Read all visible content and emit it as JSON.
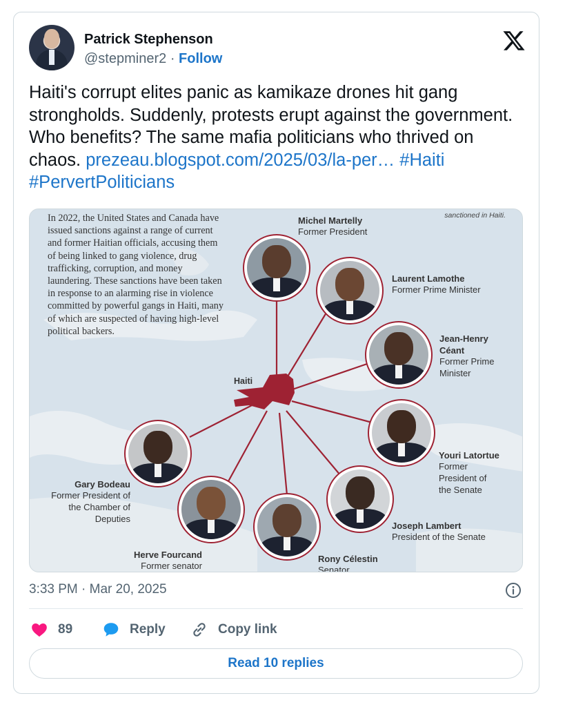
{
  "author": {
    "name": "Patrick Stephenson",
    "handle": "@stepminer2",
    "separator": "·",
    "follow_label": "Follow"
  },
  "tweet": {
    "text": "Haiti's corrupt elites panic as kamikaze drones hit gang strongholds. Suddenly, protests erupt against the government. Who benefits? The same mafia politicians who thrived on chaos.",
    "link": "prezeau.blogspot.com/2025/03/la-per…",
    "hashtags": [
      "#Haiti",
      "#PervertPoliticians"
    ]
  },
  "media": {
    "intro": "In 2022, the United States and Canada have issued sanctions against a range of current and former Haitian officials, accusing them of being linked to gang violence, drug trafficking, corruption, and money laundering. These sanctions have been taken in response to an alarming rise in violence committed by powerful gangs in Haiti, many of which are suspected of having high-level political backers.",
    "corner_note": "sanctioned in Haiti.",
    "center_label": "Haiti",
    "accent_color": "#9e2233",
    "people": [
      {
        "name": "Michel Martelly",
        "role": "Former President"
      },
      {
        "name": "Laurent Lamothe",
        "role": "Former Prime Minister"
      },
      {
        "name": "Jean-Henry Céant",
        "role": "Former Prime Minister"
      },
      {
        "name": "Youri Latortue",
        "role": "Former President of the Senate"
      },
      {
        "name": "Joseph Lambert",
        "role": "President of the Senate"
      },
      {
        "name": "Rony Célestin",
        "role": "Senator"
      },
      {
        "name": "Herve Fourcand",
        "role": "Former senator"
      },
      {
        "name": "Gary Bodeau",
        "role": "Former President of the Chamber of Deputies"
      }
    ]
  },
  "meta": {
    "time": "3:33 PM",
    "date": "Mar 20, 2025",
    "separator": "·"
  },
  "actions": {
    "like_count": "89",
    "reply_label": "Reply",
    "copy_link_label": "Copy link",
    "read_replies_label": "Read 10 replies"
  },
  "icons": {
    "like": "heart-icon",
    "reply": "speech-bubble-icon",
    "copy": "link-icon",
    "info": "info-icon",
    "brand": "x-logo-icon"
  },
  "colors": {
    "link": "#1d75c9",
    "like": "#f91880",
    "reply": "#1d9bf0"
  }
}
